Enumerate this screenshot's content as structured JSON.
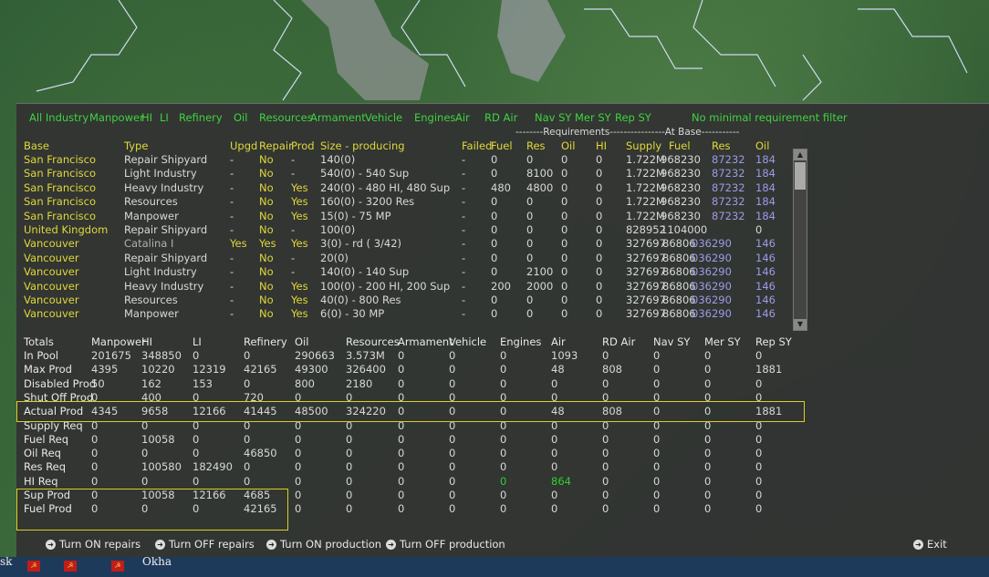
{
  "filters": [
    "All Industry",
    "Manpower",
    "HI",
    "LI",
    "Refinery",
    "Oil",
    "Resources",
    "Armament",
    "Vehicle",
    "Engines",
    "Air",
    "RD Air",
    "Nav SY",
    "Mer SY",
    "Rep SY",
    "No minimal requirement filter"
  ],
  "group_headers": {
    "requirements": "--------Requirements----------------At Base-----------"
  },
  "columns": [
    "Base",
    "Type",
    "Upgd",
    "Repair",
    "Prod",
    "Size - producing",
    "Failed",
    "Fuel",
    "Res",
    "Oil",
    "HI",
    "Supply",
    "Fuel",
    "Res",
    "Oil"
  ],
  "rows": [
    {
      "base": "San Francisco",
      "type": "Repair Shipyard",
      "upgd": "-",
      "repair": "No",
      "prod": "-",
      "size": "140(0)",
      "failed": "-",
      "fuel": "0",
      "res": "0",
      "oil": "0",
      "hi": "0",
      "supply": "1.722M",
      "afuel": "968230",
      "ares": "87232",
      "aoil": "184"
    },
    {
      "base": "San Francisco",
      "type": "Light Industry",
      "upgd": "-",
      "repair": "No",
      "prod": "-",
      "size": "540(0) - 540 Sup",
      "failed": "-",
      "fuel": "0",
      "res": "8100",
      "oil": "0",
      "hi": "0",
      "supply": "1.722M",
      "afuel": "968230",
      "ares": "87232",
      "aoil": "184"
    },
    {
      "base": "San Francisco",
      "type": "Heavy Industry",
      "upgd": "-",
      "repair": "No",
      "prod": "Yes",
      "size": "240(0) - 480 HI, 480 Sup",
      "failed": "-",
      "fuel": "480",
      "res": "4800",
      "oil": "0",
      "hi": "0",
      "supply": "1.722M",
      "afuel": "968230",
      "ares": "87232",
      "aoil": "184"
    },
    {
      "base": "San Francisco",
      "type": "Resources",
      "upgd": "-",
      "repair": "No",
      "prod": "Yes",
      "size": "160(0) - 3200 Res",
      "failed": "-",
      "fuel": "0",
      "res": "0",
      "oil": "0",
      "hi": "0",
      "supply": "1.722M",
      "afuel": "968230",
      "ares": "87232",
      "aoil": "184"
    },
    {
      "base": "San Francisco",
      "type": "Manpower",
      "upgd": "-",
      "repair": "No",
      "prod": "Yes",
      "size": "15(0) - 75 MP",
      "failed": "-",
      "fuel": "0",
      "res": "0",
      "oil": "0",
      "hi": "0",
      "supply": "1.722M",
      "afuel": "968230",
      "ares": "87232",
      "aoil": "184"
    },
    {
      "base": "United Kingdom",
      "type": "Repair Shipyard",
      "upgd": "-",
      "repair": "No",
      "prod": "-",
      "size": "100(0)",
      "failed": "-",
      "fuel": "0",
      "res": "0",
      "oil": "0",
      "hi": "0",
      "supply": "828952",
      "afuel": "1104000",
      "ares": "",
      "aoil": "0"
    },
    {
      "base": "Vancouver",
      "type": "Catalina I",
      "upgd": "Yes",
      "repair": "Yes",
      "prod": "Yes",
      "size": "3(0) - rd ( 3/42)",
      "failed": "-",
      "fuel": "0",
      "res": "0",
      "oil": "0",
      "hi": "0",
      "supply": "327697",
      "afuel": "86806",
      "ares": "036290",
      "aoil": "146"
    },
    {
      "base": "Vancouver",
      "type": "Repair Shipyard",
      "upgd": "-",
      "repair": "No",
      "prod": "-",
      "size": "20(0)",
      "failed": "-",
      "fuel": "0",
      "res": "0",
      "oil": "0",
      "hi": "0",
      "supply": "327697",
      "afuel": "86806",
      "ares": "036290",
      "aoil": "146"
    },
    {
      "base": "Vancouver",
      "type": "Light Industry",
      "upgd": "-",
      "repair": "No",
      "prod": "-",
      "size": "140(0) - 140 Sup",
      "failed": "-",
      "fuel": "0",
      "res": "2100",
      "oil": "0",
      "hi": "0",
      "supply": "327697",
      "afuel": "86806",
      "ares": "036290",
      "aoil": "146"
    },
    {
      "base": "Vancouver",
      "type": "Heavy Industry",
      "upgd": "-",
      "repair": "No",
      "prod": "Yes",
      "size": "100(0) - 200 HI, 200 Sup",
      "failed": "-",
      "fuel": "200",
      "res": "2000",
      "oil": "0",
      "hi": "0",
      "supply": "327697",
      "afuel": "86806",
      "ares": "036290",
      "aoil": "146"
    },
    {
      "base": "Vancouver",
      "type": "Resources",
      "upgd": "-",
      "repair": "No",
      "prod": "Yes",
      "size": "40(0) - 800 Res",
      "failed": "-",
      "fuel": "0",
      "res": "0",
      "oil": "0",
      "hi": "0",
      "supply": "327697",
      "afuel": "86806",
      "ares": "036290",
      "aoil": "146"
    },
    {
      "base": "Vancouver",
      "type": "Manpower",
      "upgd": "-",
      "repair": "No",
      "prod": "Yes",
      "size": "6(0) - 30 MP",
      "failed": "-",
      "fuel": "0",
      "res": "0",
      "oil": "0",
      "hi": "0",
      "supply": "327697",
      "afuel": "86806",
      "ares": "036290",
      "aoil": "146"
    }
  ],
  "totals_columns": [
    "Totals",
    "Manpower",
    "HI",
    "LI",
    "Refinery",
    "Oil",
    "Resources",
    "Armament",
    "Vehicle",
    "Engines",
    "Air",
    "RD Air",
    "Nav SY",
    "Mer SY",
    "Rep SY"
  ],
  "totals": [
    {
      "label": "In Pool",
      "v": [
        "201675",
        "348850",
        "0",
        "0",
        "290663",
        "3.573M",
        "0",
        "0",
        "0",
        "1093",
        "0",
        "0",
        "0",
        "0"
      ]
    },
    {
      "label": "Max Prod",
      "v": [
        "4395",
        "10220",
        "12319",
        "42165",
        "49300",
        "326400",
        "0",
        "0",
        "0",
        "48",
        "808",
        "0",
        "0",
        "1881"
      ]
    },
    {
      "label": "Disabled Prod",
      "v": [
        "50",
        "162",
        "153",
        "0",
        "800",
        "2180",
        "0",
        "0",
        "0",
        "0",
        "0",
        "0",
        "0",
        "0"
      ]
    },
    {
      "label": "Shut Off Prod",
      "v": [
        "0",
        "400",
        "0",
        "720",
        "0",
        "0",
        "0",
        "0",
        "0",
        "0",
        "0",
        "0",
        "0",
        "0"
      ]
    },
    {
      "label": "Actual Prod",
      "v": [
        "4345",
        "9658",
        "12166",
        "41445",
        "48500",
        "324220",
        "0",
        "0",
        "0",
        "48",
        "808",
        "0",
        "0",
        "1881"
      ]
    },
    {
      "label": "Supply Req",
      "v": [
        "0",
        "0",
        "0",
        "0",
        "0",
        "0",
        "0",
        "0",
        "0",
        "0",
        "0",
        "0",
        "0",
        "0"
      ]
    },
    {
      "label": "Fuel Req",
      "v": [
        "0",
        "10058",
        "0",
        "0",
        "0",
        "0",
        "0",
        "0",
        "0",
        "0",
        "0",
        "0",
        "0",
        "0"
      ]
    },
    {
      "label": "Oil Req",
      "v": [
        "0",
        "0",
        "0",
        "46850",
        "0",
        "0",
        "0",
        "0",
        "0",
        "0",
        "0",
        "0",
        "0",
        "0"
      ]
    },
    {
      "label": "Res Req",
      "v": [
        "0",
        "100580",
        "182490",
        "0",
        "0",
        "0",
        "0",
        "0",
        "0",
        "0",
        "0",
        "0",
        "0",
        "0"
      ]
    },
    {
      "label": "HI Req",
      "v": [
        "0",
        "0",
        "0",
        "0",
        "0",
        "0",
        "0",
        "0",
        "0",
        "864",
        "0",
        "0",
        "0",
        "0"
      ]
    },
    {
      "label": "Sup Prod",
      "v": [
        "0",
        "10058",
        "12166",
        "4685",
        "0",
        "0",
        "0",
        "0",
        "0",
        "0",
        "0",
        "0",
        "0",
        "0"
      ]
    },
    {
      "label": "Fuel Prod",
      "v": [
        "0",
        "0",
        "0",
        "42165",
        "0",
        "0",
        "0",
        "0",
        "0",
        "0",
        "0",
        "0",
        "0",
        "0"
      ]
    }
  ],
  "buttons": {
    "turn_on_repairs": "Turn ON repairs",
    "turn_off_repairs": "Turn OFF repairs",
    "turn_on_production": "Turn ON production",
    "turn_off_production": "Turn OFF production",
    "exit": "Exit"
  },
  "map_labels": {
    "okha": "Okha",
    "sk": "sk"
  },
  "colors": {
    "filter": "#3fd43f",
    "header": "#e0d83a",
    "highlight": "#d8d020",
    "at_base_res": "#9b9be8",
    "green_value": "#2fcf2f"
  }
}
